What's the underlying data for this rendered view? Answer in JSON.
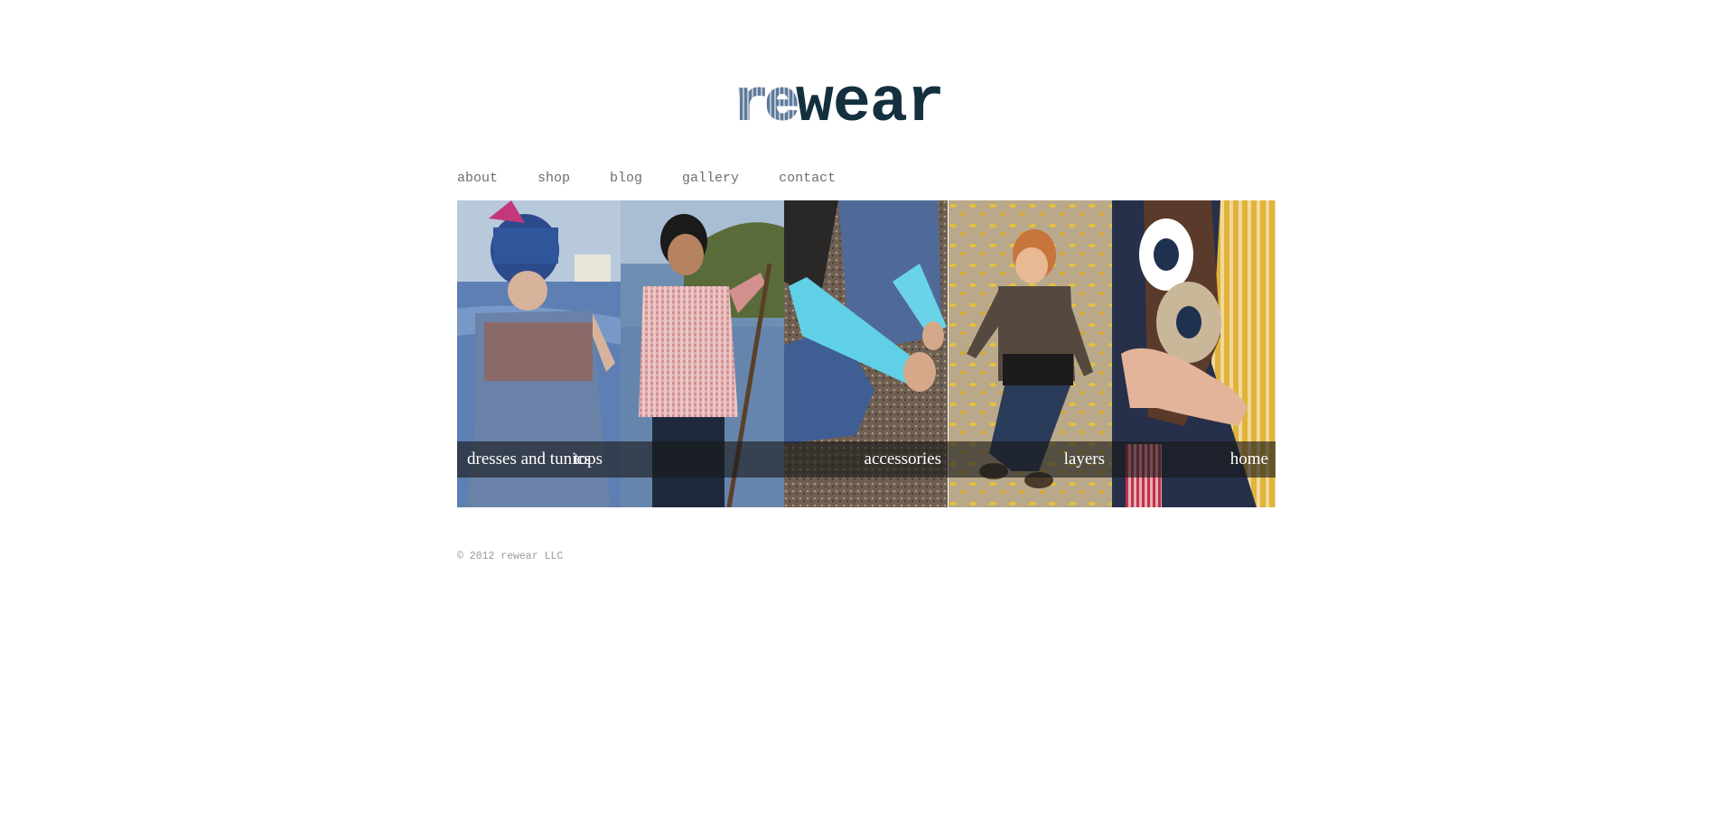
{
  "logo": {
    "prefix": "re",
    "main": "wear"
  },
  "nav": {
    "items": [
      "about",
      "shop",
      "blog",
      "gallery",
      "contact"
    ]
  },
  "categories": [
    {
      "label": "dresses and tunics"
    },
    {
      "label": "tops"
    },
    {
      "label": "accessories"
    },
    {
      "label": "layers"
    },
    {
      "label": "home"
    }
  ],
  "footer": {
    "copyright": "© 2012 rewear LLC"
  },
  "colors": {
    "logo_prefix": "#5e7a9c",
    "logo_main": "#14303f",
    "nav_text": "#6e6e6e",
    "caption_bar": "rgba(25,25,25,0.62)",
    "footer_text": "#9a9a9a"
  }
}
